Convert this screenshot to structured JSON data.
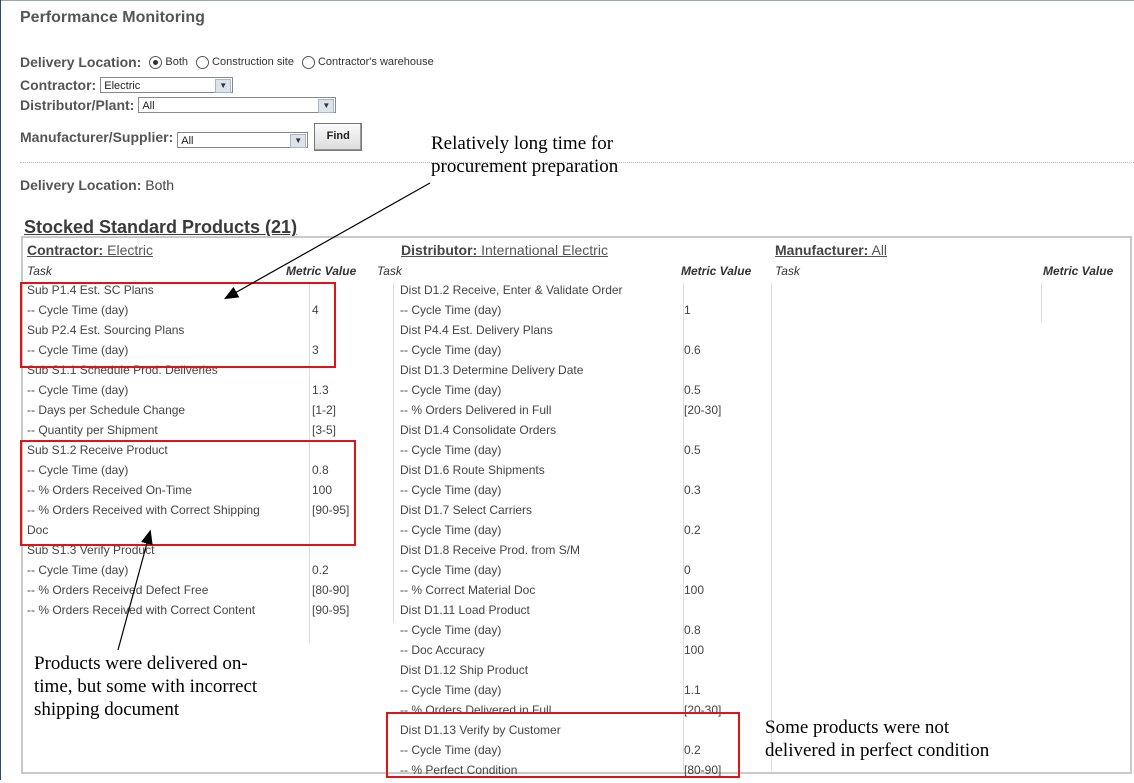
{
  "page_title": "Performance Monitoring",
  "filters": {
    "delivery_location_label": "Delivery Location:",
    "radio_options": [
      "Both",
      "Construction site",
      "Contractor's warehouse"
    ],
    "selected_radio": "Both",
    "contractor_label": "Contractor:",
    "contractor_value": "Electric",
    "distributor_label": "Distributor/Plant:",
    "distributor_value": "All",
    "manufacturer_label": "Manufacturer/Supplier:",
    "manufacturer_value": "All",
    "find_label": "Find"
  },
  "result": {
    "delivery_location_label": "Delivery Location:",
    "delivery_location_value": "Both"
  },
  "section_title": "Stocked Standard Products (21)",
  "columns": [
    {
      "head_label": "Contractor:",
      "head_value": "Electric",
      "task_header": "Task",
      "metric_header": "Metric Value",
      "rows": [
        {
          "task": "Sub P1.4 Est. SC Plans",
          "value": ""
        },
        {
          "task": "-- Cycle Time (day)",
          "value": "4"
        },
        {
          "task": "Sub P2.4 Est. Sourcing Plans",
          "value": ""
        },
        {
          "task": "-- Cycle Time (day)",
          "value": "3"
        },
        {
          "task": "Sub S1.1 Schedule Prod. Deliveries",
          "value": ""
        },
        {
          "task": "-- Cycle Time (day)",
          "value": "1.3"
        },
        {
          "task": "-- Days per Schedule Change",
          "value": "[1-2]"
        },
        {
          "task": "-- Quantity per Shipment",
          "value": "[3-5]"
        },
        {
          "task": "Sub S1.2 Receive Product",
          "value": ""
        },
        {
          "task": "-- Cycle Time (day)",
          "value": "0.8"
        },
        {
          "task": "-- % Orders Received On-Time",
          "value": "100"
        },
        {
          "task": "-- % Orders Received with Correct Shipping",
          "value": "[90-95]"
        },
        {
          "task": "Doc",
          "value": ""
        },
        {
          "task": "Sub S1.3 Verify Product",
          "value": ""
        },
        {
          "task": "-- Cycle Time (day)",
          "value": "0.2"
        },
        {
          "task": "-- % Orders Received Defect Free",
          "value": "[80-90]"
        },
        {
          "task": "-- % Orders Received with Correct Content",
          "value": "[90-95]"
        }
      ]
    },
    {
      "head_label": "Distributor:",
      "head_value": "International Electric",
      "task_header": "Task",
      "metric_header": "Metric Value",
      "rows": [
        {
          "task": "Dist D1.2 Receive, Enter & Validate Order",
          "value": ""
        },
        {
          "task": "-- Cycle Time (day)",
          "value": "1"
        },
        {
          "task": "Dist P4.4 Est. Delivery Plans",
          "value": ""
        },
        {
          "task": "-- Cycle Time (day)",
          "value": "0.6"
        },
        {
          "task": "Dist D1.3 Determine Delivery Date",
          "value": ""
        },
        {
          "task": "-- Cycle Time (day)",
          "value": "0.5"
        },
        {
          "task": "-- % Orders Delivered in Full",
          "value": "[20-30]"
        },
        {
          "task": "Dist D1.4 Consolidate Orders",
          "value": ""
        },
        {
          "task": "-- Cycle Time (day)",
          "value": "0.5"
        },
        {
          "task": "Dist D1.6 Route Shipments",
          "value": ""
        },
        {
          "task": "-- Cycle Time (day)",
          "value": "0.3"
        },
        {
          "task": "Dist D1.7 Select Carriers",
          "value": ""
        },
        {
          "task": "-- Cycle Time (day)",
          "value": "0.2"
        },
        {
          "task": "Dist D1.8 Receive Prod. from S/M",
          "value": ""
        },
        {
          "task": "-- Cycle Time (day)",
          "value": "0"
        },
        {
          "task": "-- % Correct Material Doc",
          "value": "100"
        },
        {
          "task": "Dist D1.11 Load Product",
          "value": ""
        },
        {
          "task": "-- Cycle Time (day)",
          "value": "0.8"
        },
        {
          "task": "-- Doc Accuracy",
          "value": "100"
        },
        {
          "task": "Dist D1.12 Ship Product",
          "value": ""
        },
        {
          "task": "-- Cycle Time (day)",
          "value": "1.1"
        },
        {
          "task": "-- % Orders Delivered in Full",
          "value": "[20-30]"
        },
        {
          "task": "Dist D1.13 Verify by Customer",
          "value": ""
        },
        {
          "task": "-- Cycle Time (day)",
          "value": "0.2"
        },
        {
          "task": "-- % Perfect Condition",
          "value": "[80-90]"
        }
      ]
    },
    {
      "head_label": "Manufacturer:",
      "head_value": "All",
      "task_header": "Task",
      "metric_header": "Metric Value",
      "rows": []
    }
  ],
  "annotations": {
    "procurement": [
      "Relatively long time for",
      "procurement preparation"
    ],
    "delivered": [
      "Products were delivered on-",
      "time, but some with incorrect",
      "shipping document"
    ],
    "condition": [
      "Some products were not",
      "delivered in perfect condition"
    ]
  },
  "colors": {
    "highlight_box": "#e01414",
    "grid_line": "#dddddd",
    "table_border": "#c9c9c9"
  }
}
